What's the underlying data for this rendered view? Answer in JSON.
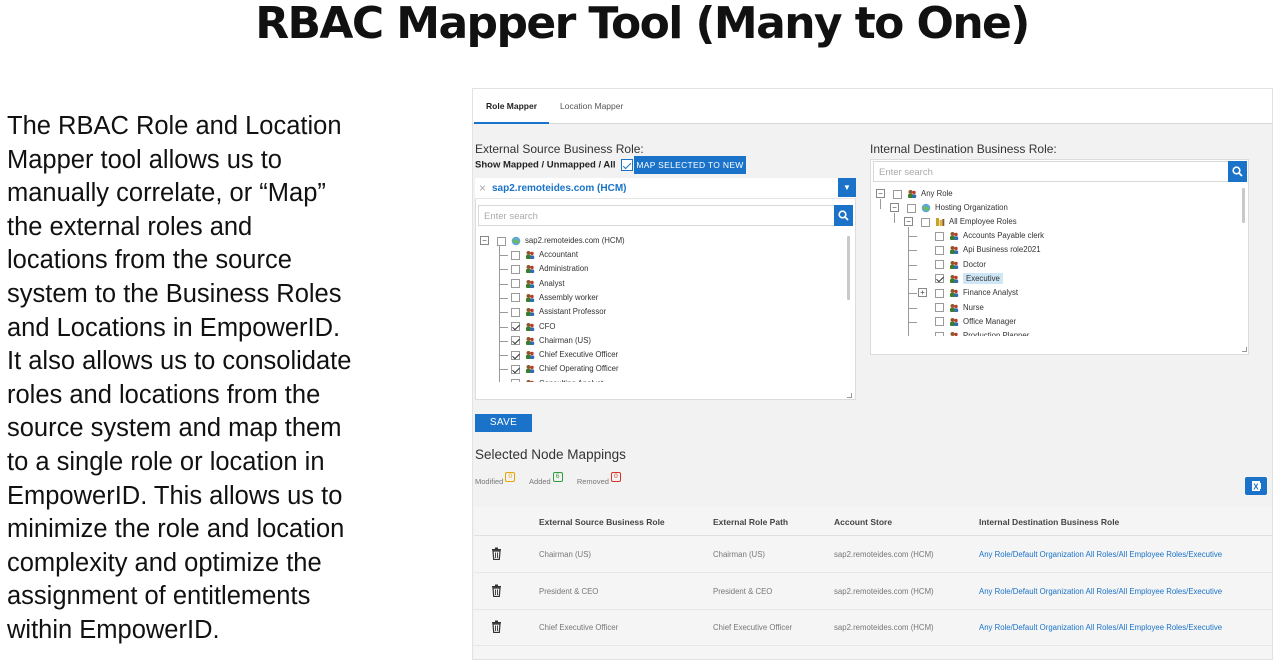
{
  "slide": {
    "title": "RBAC Mapper Tool (Many to One)",
    "description": "The RBAC Role and Location\nMapper tool allows us to\nmanually correlate, or “Map”\nthe external roles and\nlocations from the source\nsystem to the Business Roles\nand Locations in EmpowerID.\nIt also allows us to consolidate\nroles and locations from the\nsource system and map them\nto a single role or location in\nEmpowerID.  This allows us to\nminimize the role and location\ncomplexity and optimize the\nassignment of entitlements\nwithin EmpowerID."
  },
  "tabs": [
    {
      "label": "Role Mapper",
      "active": true
    },
    {
      "label": "Location Mapper",
      "active": false
    }
  ],
  "source": {
    "heading": "External Source Business Role:",
    "show_mapped_label": "Show Mapped / Unmapped / All",
    "show_mapped_checked": true,
    "map_button": "MAP SELECTED TO NEW",
    "selected_system": "sap2.remoteides.com (HCM)",
    "search_placeholder": "Enter search",
    "tree_root": "sap2.remoteides.com (HCM)",
    "tree_items": [
      {
        "label": "Accountant",
        "checked": false
      },
      {
        "label": "Administration",
        "checked": false
      },
      {
        "label": "Analyst",
        "checked": false
      },
      {
        "label": "Assembly worker",
        "checked": false
      },
      {
        "label": "Assistant Professor",
        "checked": false
      },
      {
        "label": "CFO",
        "checked": true
      },
      {
        "label": "Chairman (US)",
        "checked": true
      },
      {
        "label": "Chief Executive Officer",
        "checked": true
      },
      {
        "label": "Chief Operating Officer",
        "checked": true
      },
      {
        "label": "Consulting Analyst",
        "checked": false
      }
    ]
  },
  "destination": {
    "heading": "Internal Destination Business Role:",
    "search_placeholder": "Enter search",
    "tree": {
      "root": "Any Role",
      "level1": "Hosting Organization",
      "level2": "All Employee Roles",
      "items": [
        {
          "label": "Accounts Payable clerk",
          "checked": false,
          "selected": false,
          "expandable": false
        },
        {
          "label": "Api Business role2021",
          "checked": false,
          "selected": false,
          "expandable": false
        },
        {
          "label": "Doctor",
          "checked": false,
          "selected": false,
          "expandable": false
        },
        {
          "label": "Executive",
          "checked": true,
          "selected": true,
          "expandable": false
        },
        {
          "label": "Finance Analyst",
          "checked": false,
          "selected": false,
          "expandable": true
        },
        {
          "label": "Nurse",
          "checked": false,
          "selected": false,
          "expandable": false
        },
        {
          "label": "Office Manager",
          "checked": false,
          "selected": false,
          "expandable": false
        },
        {
          "label": "Production Planner",
          "checked": false,
          "selected": false,
          "expandable": false
        }
      ]
    }
  },
  "save_button": "SAVE",
  "mappings": {
    "heading": "Selected Node Mappings",
    "legend": [
      {
        "label": "Modified",
        "count": "0",
        "color": "#e8a400"
      },
      {
        "label": "Added",
        "count": "6",
        "color": "#2e9e3a"
      },
      {
        "label": "Removed",
        "count": "0",
        "color": "#d93025"
      }
    ],
    "columns": [
      "External Source Business Role",
      "External Role Path",
      "Account Store",
      "Internal Destination Business Role"
    ],
    "rows": [
      {
        "role": "Chairman (US)",
        "path": "Chairman (US)",
        "store": "sap2.remoteides.com (HCM)",
        "dest": "Any Role/Default Organization All Roles/All Employee Roles/Executive"
      },
      {
        "role": "President & CEO",
        "path": "President & CEO",
        "store": "sap2.remoteides.com (HCM)",
        "dest": "Any Role/Default Organization All Roles/All Employee Roles/Executive"
      },
      {
        "role": "Chief Executive Officer",
        "path": "Chief Executive Officer",
        "store": "sap2.remoteides.com (HCM)",
        "dest": "Any Role/Default Organization All Roles/All Employee Roles/Executive"
      }
    ]
  },
  "colors": {
    "accent": "#1a73c8",
    "selected_row": "#cfe6f7"
  },
  "icons": [
    "checkbox-icon",
    "search-icon",
    "chevron-down-icon",
    "role-icon",
    "organization-icon",
    "folder-icon",
    "trash-icon",
    "excel-export-icon",
    "tree-expander-icon"
  ]
}
